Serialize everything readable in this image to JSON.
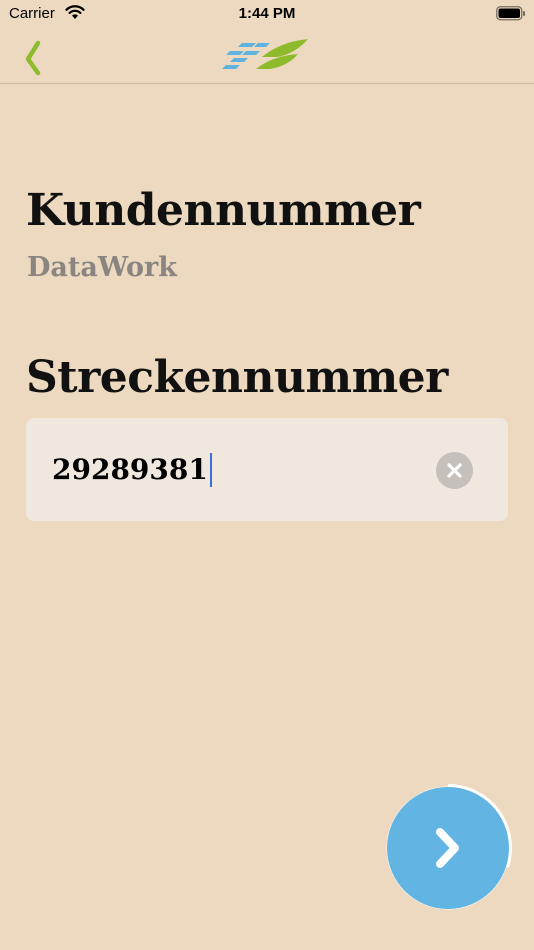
{
  "status_bar": {
    "carrier": "Carrier",
    "time": "1:44 PM"
  },
  "nav": {
    "back_icon": "chevron-left-icon",
    "logo": "app-logo",
    "accent_color": "#8dbb2b"
  },
  "customer": {
    "label": "Kundennummer",
    "value": "DataWork"
  },
  "route": {
    "label": "Streckennummer",
    "input_value": "29289381",
    "clear_icon": "clear-icon"
  },
  "next_button": {
    "icon": "chevron-right-icon",
    "color": "#62b5e2",
    "progress": 0.3
  }
}
